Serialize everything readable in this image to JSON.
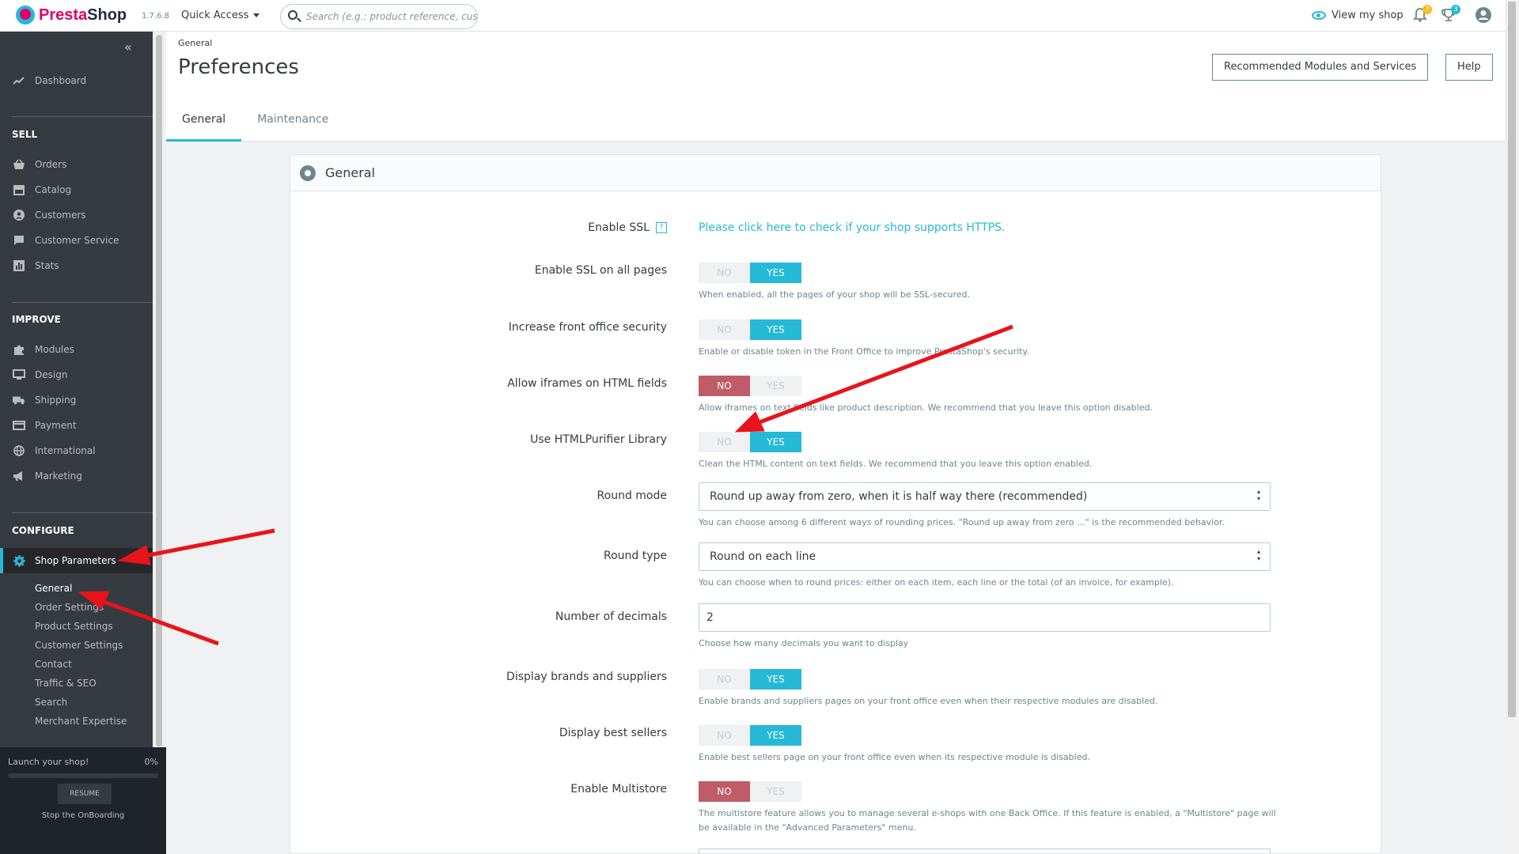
{
  "topbar": {
    "logo_text_a": "Presta",
    "logo_text_b": "Shop",
    "version": "1.7.6.8",
    "quick_access": "Quick Access",
    "search_placeholder": "Search (e.g.: product reference, customer name…)",
    "view_shop": "View my shop",
    "notif_orders": "7",
    "notif_customers": "3"
  },
  "sidebar": {
    "dashboard": "Dashboard",
    "sections": {
      "sell": "SELL",
      "improve": "IMPROVE",
      "configure": "CONFIGURE"
    },
    "sell_items": [
      "Orders",
      "Catalog",
      "Customers",
      "Customer Service",
      "Stats"
    ],
    "improve_items": [
      "Modules",
      "Design",
      "Shipping",
      "Payment",
      "International",
      "Marketing"
    ],
    "active_item": "Shop Parameters",
    "sub_items": [
      "General",
      "Order Settings",
      "Product Settings",
      "Customer Settings",
      "Contact",
      "Traffic & SEO",
      "Search",
      "Merchant Expertise"
    ],
    "active_sub": "General"
  },
  "onboarding": {
    "title": "Launch your shop!",
    "percent": "0%",
    "progress": 0,
    "resume": "RESUME",
    "stop": "Stop the OnBoarding"
  },
  "header": {
    "breadcrumb": "General",
    "title": "Preferences",
    "btn_modules": "Recommended Modules and Services",
    "btn_help": "Help",
    "tabs": [
      "General",
      "Maintenance"
    ],
    "active_tab": "General"
  },
  "panel": {
    "title": "General",
    "fields": {
      "ssl": {
        "label": "Enable SSL",
        "link": "Please click here to check if your shop supports HTTPS."
      },
      "ssl_all": {
        "label": "Enable SSL on all pages",
        "value": "YES",
        "help": "When enabled, all the pages of your shop will be SSL-secured."
      },
      "security": {
        "label": "Increase front office security",
        "value": "YES",
        "help": "Enable or disable token in the Front Office to improve PrestaShop's security."
      },
      "iframes": {
        "label": "Allow iframes on HTML fields",
        "value": "NO",
        "help": "Allow iframes on text fields like product description. We recommend that you leave this option disabled."
      },
      "purifier": {
        "label": "Use HTMLPurifier Library",
        "value": "YES",
        "help": "Clean the HTML content on text fields. We recommend that you leave this option enabled."
      },
      "round_mode": {
        "label": "Round mode",
        "value": "Round up away from zero, when it is half way there (recommended)",
        "help": "You can choose among 6 different ways of rounding prices. \"Round up away from zero ...\" is the recommended behavior."
      },
      "round_type": {
        "label": "Round type",
        "value": "Round on each line",
        "help": "You can choose when to round prices: either on each item, each line or the total (of an invoice, for example)."
      },
      "decimals": {
        "label": "Number of decimals",
        "value": "2",
        "help": "Choose how many decimals you want to display"
      },
      "brands": {
        "label": "Display brands and suppliers",
        "value": "YES",
        "help": "Enable brands and suppliers pages on your front office even when their respective modules are disabled."
      },
      "bestsellers": {
        "label": "Display best sellers",
        "value": "YES",
        "help": "Enable best sellers page on your front office even when its respective module is disabled."
      },
      "multistore": {
        "label": "Enable Multistore",
        "value": "NO",
        "help": "The multistore feature allows you to manage several e-shops with one Back Office. If this feature is enabled, a \"Multistore\" page will be available in the \"Advanced Parameters\" menu."
      }
    },
    "switch_no": "NO",
    "switch_yes": "YES"
  },
  "colors": {
    "accent": "#25b9d7",
    "sidebar": "#363a41",
    "no_active": "#c05c67",
    "brand": "#df0067",
    "annotation_arrow": "#e8141a"
  }
}
